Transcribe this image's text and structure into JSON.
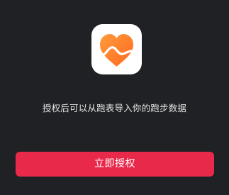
{
  "dialog": {
    "app_icon": {
      "name": "heart-pulse-icon",
      "colors": [
        "#ff7a2c",
        "#ffa64c"
      ]
    },
    "description": "授权后可以从跑表导入你的跑步数据",
    "authorize_button": {
      "label": "立即授权",
      "color": "#e8294a"
    }
  }
}
